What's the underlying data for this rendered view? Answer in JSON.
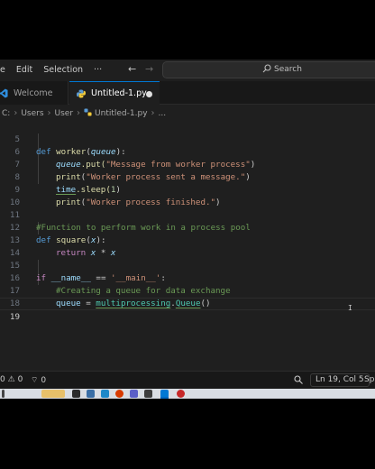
{
  "menu": {
    "edit": "Edit",
    "selection": "Selection",
    "more": "···"
  },
  "search": {
    "label": "Search"
  },
  "tabs": {
    "welcome": "Welcome",
    "file": "Untitled-1.py"
  },
  "breadcrumb": {
    "drive": "C:",
    "users": "Users",
    "user": "User",
    "file": "Untitled-1.py",
    "more": "..."
  },
  "editor": {
    "lines": [
      {
        "n": "5"
      },
      {
        "n": "6"
      },
      {
        "n": "7"
      },
      {
        "n": "8"
      },
      {
        "n": "9"
      },
      {
        "n": "10"
      },
      {
        "n": "11"
      },
      {
        "n": "12"
      },
      {
        "n": "13"
      },
      {
        "n": "14"
      },
      {
        "n": "15"
      },
      {
        "n": "16"
      },
      {
        "n": "17"
      },
      {
        "n": "18"
      },
      {
        "n": "19"
      }
    ],
    "tokens": {
      "def": "def ",
      "worker": "worker",
      "queue": "queue",
      "paren_colon": "):",
      "l6_put": ".put(",
      "l6_str": "\"Message from worker process\"",
      "close": ")",
      "print": "print",
      "open": "(",
      "l7_str": "\"Worker process sent a message.\"",
      "time": "time",
      "sleep": ".sleep(",
      "one": "1",
      "l9_str": "\"Worker process finished.\"",
      "l11_cmt": "#Function to perform work in a process pool",
      "square": "square",
      "x": "x",
      "return": "return ",
      "times": " * ",
      "if": "if ",
      "name": "__name__",
      "eq": " == ",
      "main_str": "'__main__'",
      "colon": ":",
      "l16_cmt": "#Creating a queue for data exchange",
      "queue_var": "queue",
      "assign": " = ",
      "mp": "multiprocessing",
      "dot": ".",
      "Queue": "Queue",
      "call": "()"
    }
  },
  "status": {
    "errors": "0",
    "warnings": "0",
    "ports": "0",
    "position": "Ln 19, Col 5",
    "spaces": "Sp"
  },
  "colors": {
    "accent": "#0078d4",
    "editor_bg": "#1f1f1f",
    "keyword": "#569cd6",
    "string": "#ce9178",
    "comment": "#6a9955"
  }
}
